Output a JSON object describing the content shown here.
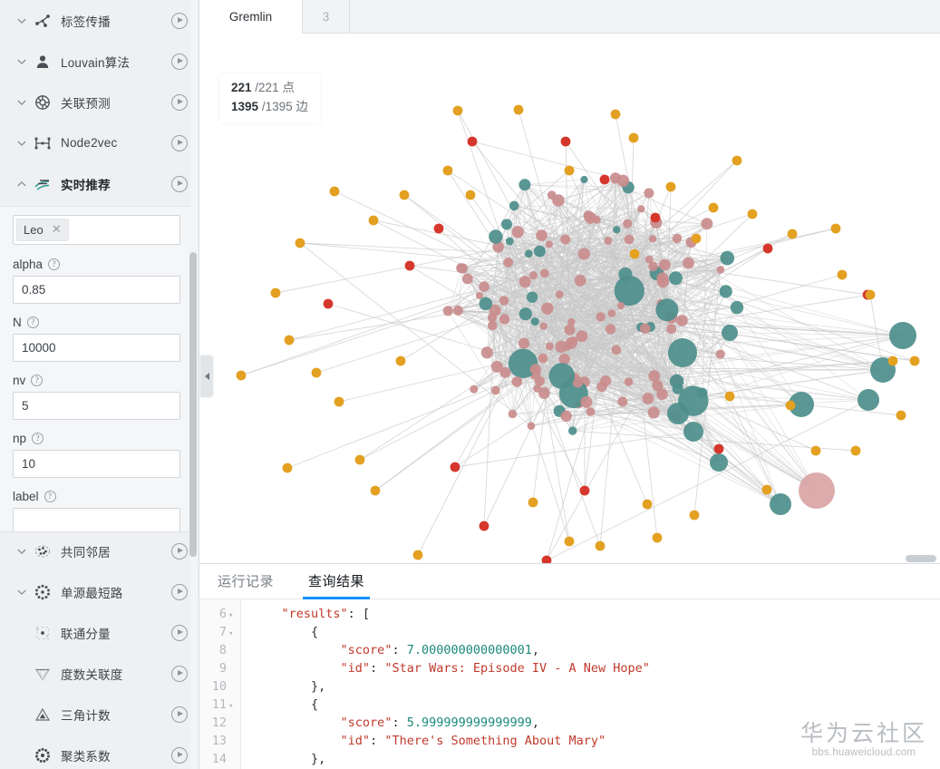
{
  "sidebar": {
    "algorithms": [
      {
        "label": "标签传播",
        "icon": "label-propagation-icon",
        "chevron": "down",
        "has_chevron": true,
        "active": false,
        "has_run": true
      },
      {
        "label": "Louvain算法",
        "icon": "louvain-icon",
        "chevron": "down",
        "has_chevron": true,
        "active": false,
        "has_run": true
      },
      {
        "label": "关联预测",
        "icon": "link-prediction-icon",
        "chevron": "down",
        "has_chevron": true,
        "active": false,
        "has_run": true
      },
      {
        "label": "Node2vec",
        "icon": "node2vec-icon",
        "chevron": "down",
        "has_chevron": true,
        "active": false,
        "has_run": true
      },
      {
        "label": "实时推荐",
        "icon": "realtime-recommend-icon",
        "chevron": "up",
        "has_chevron": true,
        "active": true,
        "has_run": true
      }
    ],
    "algorithms_lower": [
      {
        "label": "共同邻居",
        "icon": "common-neighbors-icon",
        "chevron": "down",
        "has_chevron": true,
        "active": false,
        "has_run": true
      },
      {
        "label": "单源最短路",
        "icon": "sssp-icon",
        "chevron": "down",
        "has_chevron": true,
        "active": false,
        "has_run": true
      },
      {
        "label": "联通分量",
        "icon": "connected-components-icon",
        "chevron": "none",
        "has_chevron": false,
        "active": false,
        "has_run": true
      },
      {
        "label": "度数关联度",
        "icon": "degree-correlation-icon",
        "chevron": "none",
        "has_chevron": false,
        "active": false,
        "has_run": true
      },
      {
        "label": "三角计数",
        "icon": "triangle-count-icon",
        "chevron": "none",
        "has_chevron": false,
        "active": false,
        "has_run": true
      },
      {
        "label": "聚类系数",
        "icon": "clustering-coefficient-icon",
        "chevron": "none",
        "has_chevron": false,
        "active": false,
        "has_run": true
      }
    ],
    "form": {
      "tag": {
        "text": "Leo",
        "remove_label": "✕"
      },
      "tag_placeholder": "",
      "fields": [
        {
          "label": "alpha",
          "value": "0.85",
          "help": "?"
        },
        {
          "label": "N",
          "value": "10000",
          "help": "?"
        },
        {
          "label": "nv",
          "value": "5",
          "help": "?"
        },
        {
          "label": "np",
          "value": "10",
          "help": "?"
        },
        {
          "label": "label",
          "value": "",
          "help": "?"
        }
      ]
    }
  },
  "tabs": [
    {
      "label": "Gremlin",
      "active": true
    },
    {
      "label": "3",
      "active": false
    }
  ],
  "canvas": {
    "stats": {
      "nodes_current": "221",
      "nodes_total": "/221 点",
      "edges_current": "1395",
      "edges_total": "/1395 边"
    },
    "colors": {
      "node_teal": "#4f8f8c",
      "node_rose": "#c98d8d",
      "node_pink_large": "#d9a6a6",
      "node_orange": "#e3a021",
      "node_red": "#d6372c",
      "edge": "#c9c9c9"
    }
  },
  "bottom": {
    "tabs": [
      {
        "label": "运行记录",
        "active": false
      },
      {
        "label": "查询结果",
        "active": true
      }
    ],
    "accent": "#1890ff",
    "code": {
      "lines": [
        {
          "n": "6",
          "fold": true,
          "text": "    \"results\": ["
        },
        {
          "n": "7",
          "fold": true,
          "text": "        {"
        },
        {
          "n": "8",
          "fold": false,
          "text": "            \"score\": 7.000000000000001,"
        },
        {
          "n": "9",
          "fold": false,
          "text": "            \"id\": \"Star Wars: Episode IV - A New Hope\""
        },
        {
          "n": "10",
          "fold": false,
          "text": "        },"
        },
        {
          "n": "11",
          "fold": true,
          "text": "        {"
        },
        {
          "n": "12",
          "fold": false,
          "text": "            \"score\": 5.999999999999999,"
        },
        {
          "n": "13",
          "fold": false,
          "text": "            \"id\": \"There's Something About Mary\""
        },
        {
          "n": "14",
          "fold": false,
          "text": "        },"
        }
      ]
    }
  },
  "watermark": {
    "title": "华为云社区",
    "url": "bbs.huaweicloud.com"
  }
}
